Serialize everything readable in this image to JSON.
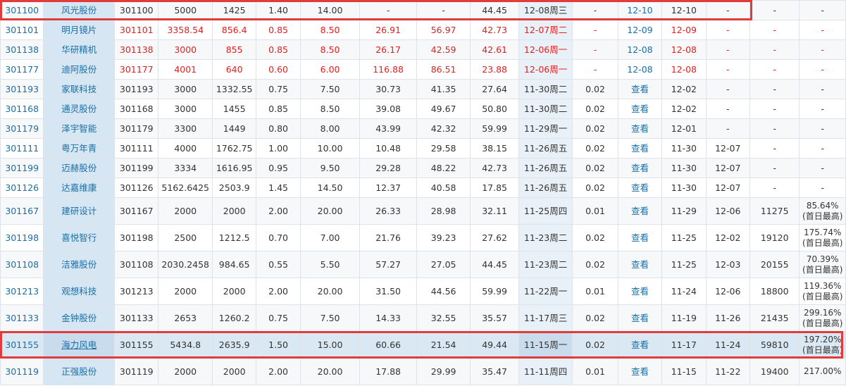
{
  "rows": [
    {
      "code": "301100",
      "name": "风光股份",
      "subcode": "301100",
      "cells": [
        "5000",
        "1425",
        "1.40",
        "14.00",
        "-",
        "-",
        "44.45"
      ],
      "date": "12-08周三",
      "c11": "-",
      "c12": "12-10",
      "c13": "12-10",
      "c14": "-",
      "c15": "-",
      "c16": "-",
      "red": false
    },
    {
      "code": "301101",
      "name": "明月镜片",
      "subcode": "301101",
      "cells": [
        "3358.54",
        "856.4",
        "0.85",
        "8.50",
        "26.91",
        "56.97",
        "42.73"
      ],
      "date": "12-07周二",
      "c11": "-",
      "c12": "12-09",
      "c13": "12-09",
      "c14": "-",
      "c15": "-",
      "c16": "-",
      "red": true
    },
    {
      "code": "301138",
      "name": "华研精机",
      "subcode": "301138",
      "cells": [
        "3000",
        "855",
        "0.85",
        "8.50",
        "26.17",
        "42.59",
        "42.61"
      ],
      "date": "12-06周一",
      "c11": "-",
      "c12": "12-08",
      "c13": "12-08",
      "c14": "-",
      "c15": "-",
      "c16": "-",
      "red": true
    },
    {
      "code": "301177",
      "name": "迪阿股份",
      "subcode": "301177",
      "cells": [
        "4001",
        "640",
        "0.60",
        "6.00",
        "116.88",
        "86.51",
        "23.88"
      ],
      "date": "12-06周一",
      "c11": "-",
      "c12": "12-08",
      "c13": "12-08",
      "c14": "-",
      "c15": "-",
      "c16": "-",
      "red": true
    },
    {
      "code": "301193",
      "name": "家联科技",
      "subcode": "301193",
      "cells": [
        "3000",
        "1332.55",
        "0.75",
        "7.50",
        "30.73",
        "41.35",
        "27.64"
      ],
      "date": "11-30周二",
      "c11": "0.02",
      "c12": "查看",
      "c13": "12-02",
      "c14": "-",
      "c15": "-",
      "c16": "-",
      "red": false
    },
    {
      "code": "301168",
      "name": "通灵股份",
      "subcode": "301168",
      "cells": [
        "3000",
        "1455",
        "0.85",
        "8.50",
        "39.08",
        "49.67",
        "50.80"
      ],
      "date": "11-30周二",
      "c11": "0.02",
      "c12": "查看",
      "c13": "12-02",
      "c14": "-",
      "c15": "-",
      "c16": "-",
      "red": false
    },
    {
      "code": "301179",
      "name": "泽宇智能",
      "subcode": "301179",
      "cells": [
        "3300",
        "1449",
        "0.80",
        "8.00",
        "43.99",
        "42.32",
        "59.99"
      ],
      "date": "11-29周一",
      "c11": "0.02",
      "c12": "查看",
      "c13": "12-01",
      "c14": "-",
      "c15": "-",
      "c16": "-",
      "red": false
    },
    {
      "code": "301111",
      "name": "粤万年青",
      "subcode": "301111",
      "cells": [
        "4000",
        "1762.75",
        "1.00",
        "10.00",
        "10.48",
        "29.58",
        "38.15"
      ],
      "date": "11-26周五",
      "c11": "0.02",
      "c12": "查看",
      "c13": "11-30",
      "c14": "12-07",
      "c15": "-",
      "c16": "-",
      "red": false
    },
    {
      "code": "301199",
      "name": "迈赫股份",
      "subcode": "301199",
      "cells": [
        "3334",
        "1616.95",
        "0.95",
        "9.50",
        "29.28",
        "48.22",
        "42.73"
      ],
      "date": "11-26周五",
      "c11": "0.02",
      "c12": "查看",
      "c13": "11-30",
      "c14": "12-07",
      "c15": "-",
      "c16": "-",
      "red": false
    },
    {
      "code": "301126",
      "name": "达嘉维康",
      "subcode": "301126",
      "cells": [
        "5162.6425",
        "2503.9",
        "1.45",
        "14.50",
        "12.37",
        "40.58",
        "17.85"
      ],
      "date": "11-26周五",
      "c11": "0.02",
      "c12": "查看",
      "c13": "11-30",
      "c14": "12-07",
      "c15": "-",
      "c16": "-",
      "red": false
    },
    {
      "code": "301167",
      "name": "建研设计",
      "subcode": "301167",
      "cells": [
        "2000",
        "2000",
        "2.00",
        "20.00",
        "26.33",
        "28.98",
        "32.11"
      ],
      "date": "11-25周四",
      "c11": "0.01",
      "c12": "查看",
      "c13": "11-29",
      "c14": "12-06",
      "c15": "11275",
      "c16a": "85.64%",
      "c16b": "(首日最高)",
      "red": false
    },
    {
      "code": "301198",
      "name": "喜悦智行",
      "subcode": "301198",
      "cells": [
        "2500",
        "1212.5",
        "0.70",
        "7.00",
        "21.76",
        "39.23",
        "27.62"
      ],
      "date": "11-23周二",
      "c11": "0.02",
      "c12": "查看",
      "c13": "11-25",
      "c14": "12-02",
      "c15": "19120",
      "c16a": "175.74%",
      "c16b": "(首日最高)",
      "red": false
    },
    {
      "code": "301108",
      "name": "洁雅股份",
      "subcode": "301108",
      "cells": [
        "2030.2458",
        "984.65",
        "0.55",
        "5.50",
        "57.27",
        "27.05",
        "44.45"
      ],
      "date": "11-23周二",
      "c11": "0.02",
      "c12": "查看",
      "c13": "11-25",
      "c14": "12-03",
      "c15": "20155",
      "c16a": "70.39%",
      "c16b": "(首日最高)",
      "red": false
    },
    {
      "code": "301213",
      "name": "观想科技",
      "subcode": "301213",
      "cells": [
        "2000",
        "2000",
        "2.00",
        "20.00",
        "31.50",
        "44.56",
        "59.99"
      ],
      "date": "11-22周一",
      "c11": "0.01",
      "c12": "查看",
      "c13": "11-24",
      "c14": "12-06",
      "c15": "18800",
      "c16a": "119.36%",
      "c16b": "(首日最高)",
      "red": false
    },
    {
      "code": "301133",
      "name": "金钟股份",
      "subcode": "301133",
      "cells": [
        "2653",
        "1260.2",
        "0.75",
        "7.50",
        "14.33",
        "32.55",
        "35.57"
      ],
      "date": "11-17周三",
      "c11": "0.02",
      "c12": "查看",
      "c13": "11-19",
      "c14": "11-26",
      "c15": "21435",
      "c16a": "299.16%",
      "c16b": "(首日最高)",
      "red": false
    },
    {
      "code": "301155",
      "name": "海力风电",
      "subcode": "301155",
      "cells": [
        "5434.8",
        "2635.9",
        "1.50",
        "15.00",
        "60.66",
        "21.54",
        "49.44"
      ],
      "date": "11-15周一",
      "c11": "0.02",
      "c12": "查看",
      "c13": "11-17",
      "c14": "11-24",
      "c15": "59810",
      "c16a": "197.20%",
      "c16b": "(首日最高)",
      "red": false
    },
    {
      "code": "301119",
      "name": "正强股份",
      "subcode": "301119",
      "cells": [
        "2000",
        "2000",
        "2.00",
        "20.00",
        "17.88",
        "29.99",
        "35.47"
      ],
      "date": "11-11周四",
      "c11": "0.01",
      "c12": "查看",
      "c13": "11-15",
      "c14": "11-22",
      "c15": "19400",
      "c16a": "217.00%",
      "c16b": "",
      "red": false
    }
  ],
  "colors": {
    "link": "#1a6fa8",
    "red": "#e02020",
    "highlight_border": "#e23b3b",
    "name_col_bg": "#d6e6f2",
    "date_col_bg": "#e8f1f8"
  }
}
